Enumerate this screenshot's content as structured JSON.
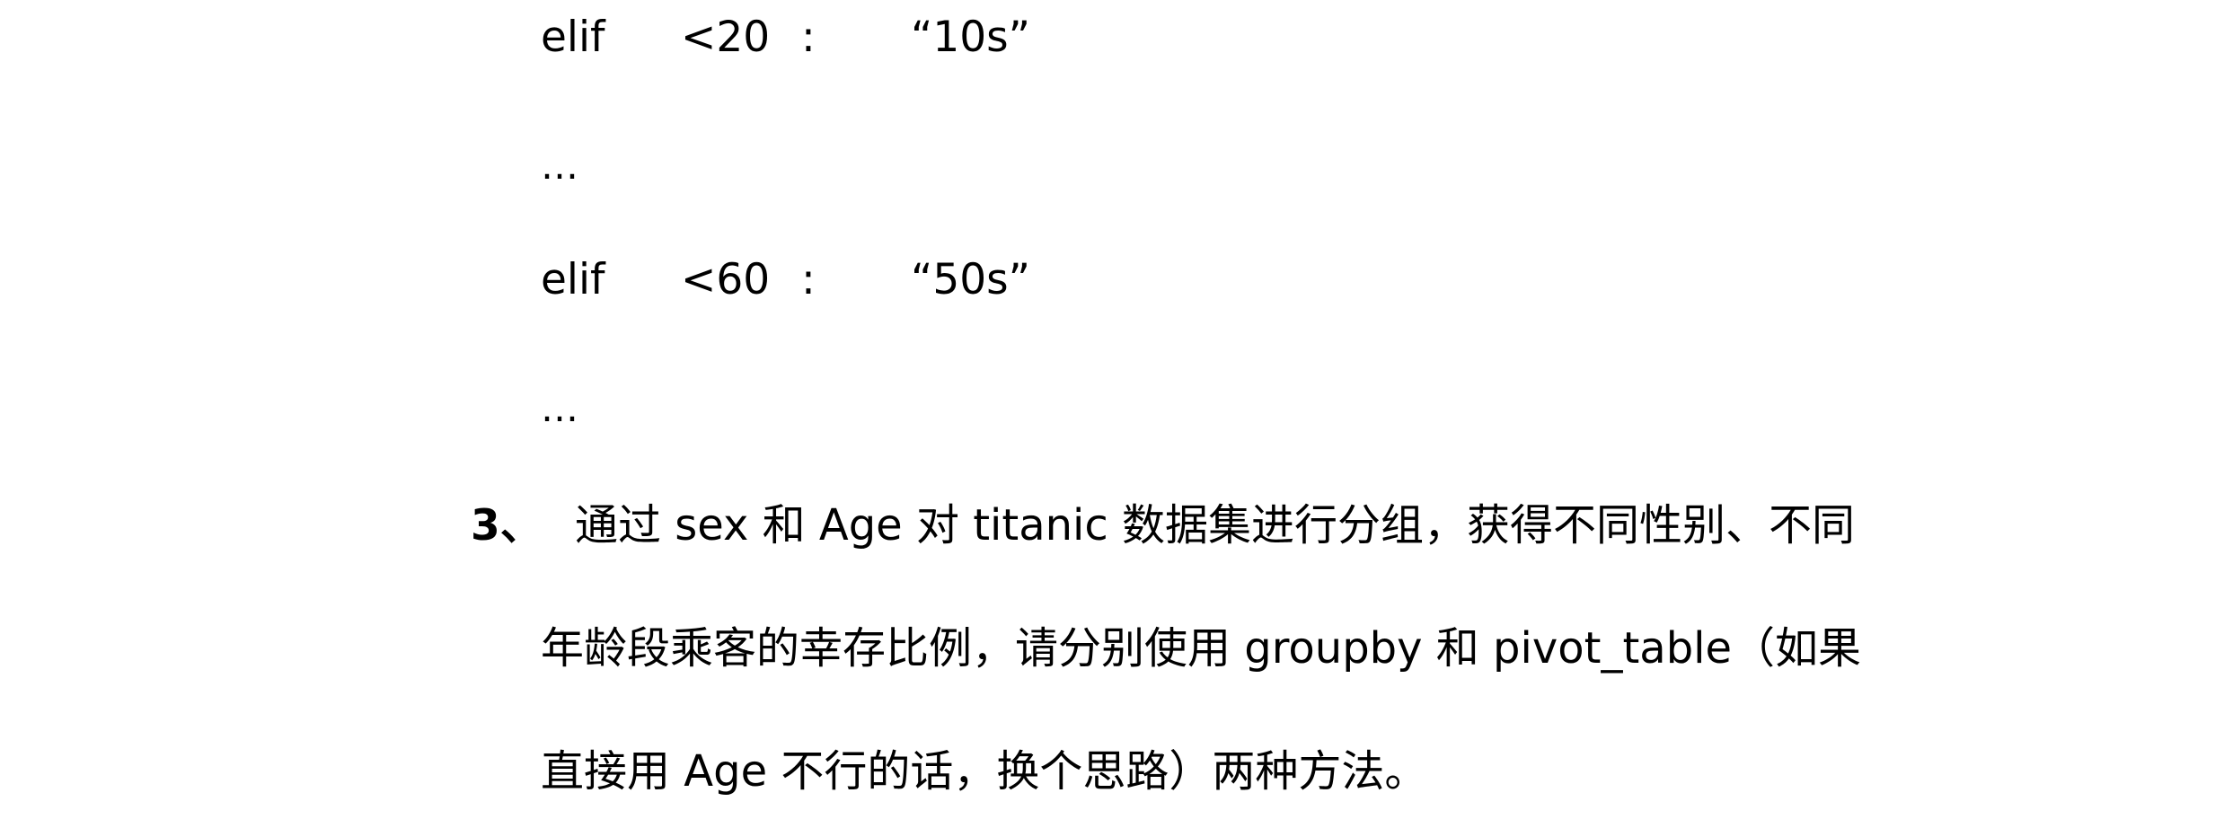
{
  "code_lines": [
    {
      "keyword": "elif",
      "condition": "<20",
      "colon": ":",
      "value": "“10s”"
    },
    {
      "keyword": "elif",
      "condition": "<60",
      "colon": ":",
      "value": "“50s”"
    }
  ],
  "ellipsis": "…",
  "item": {
    "number": "3、",
    "lines": [
      "通过 sex 和 Age 对 titanic 数据集进行分组，获得不同性别、不同",
      "年龄段乘客的幸存比例，请分别使用 groupby 和 pivot_table（如果",
      "直接用 Age 不行的话，换个思路）两种方法。"
    ]
  }
}
